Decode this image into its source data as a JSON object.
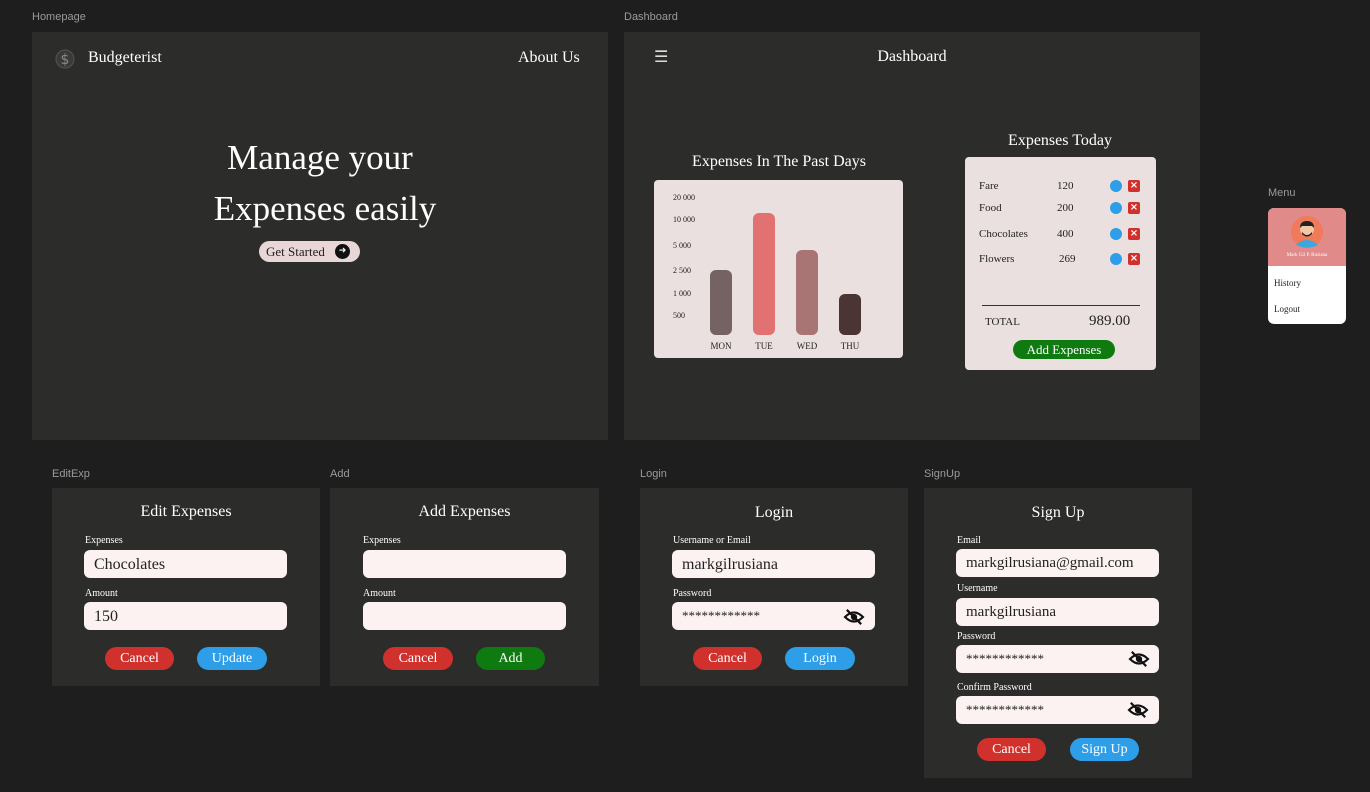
{
  "frames": {
    "homepage": "Homepage",
    "dashboard": "Dashboard",
    "menu": "Menu",
    "editexp": "EditExp",
    "add": "Add",
    "login": "Login",
    "signup": "SignUp"
  },
  "homepage": {
    "brand": "Budgeterist",
    "about": "About Us",
    "hero_line1": "Manage your",
    "hero_line2": "Expenses easily",
    "cta": "Get Started"
  },
  "dashboard": {
    "title": "Dashboard",
    "chart_title": "Expenses In The Past Days",
    "today_title": "Expenses Today",
    "items": [
      {
        "name": "Fare",
        "amount": "120"
      },
      {
        "name": "Food",
        "amount": "200"
      },
      {
        "name": "Chocolates",
        "amount": "400"
      },
      {
        "name": "Flowers",
        "amount": "269"
      }
    ],
    "total_label": "TOTAL",
    "total_value": "989.00",
    "add_button": "Add Expenses"
  },
  "chart_data": {
    "type": "bar",
    "title": "Expenses In The Past Days",
    "categories": [
      "MON",
      "TUE",
      "WED",
      "THU"
    ],
    "values": [
      1700,
      9000,
      3300,
      700
    ],
    "y_tick_labels": [
      "20 000",
      "10 000",
      "5 000",
      "2 500",
      "1 000",
      "500"
    ],
    "colors": [
      "#756363",
      "#e27272",
      "#a87474",
      "#4a3434"
    ],
    "grid": false
  },
  "menu": {
    "user": "Mark Gil P. Rusiana",
    "history": "History",
    "logout": "Logout"
  },
  "edit": {
    "title": "Edit Expenses",
    "expenses_label": "Expenses",
    "expenses_value": "Chocolates",
    "amount_label": "Amount",
    "amount_value": "150",
    "cancel": "Cancel",
    "update": "Update"
  },
  "add": {
    "title": "Add Expenses",
    "expenses_label": "Expenses",
    "amount_label": "Amount",
    "cancel": "Cancel",
    "add": "Add"
  },
  "login": {
    "title": "Login",
    "user_label": "Username or Email",
    "user_value": "markgilrusiana",
    "pass_label": "Password",
    "pass_value": "************",
    "cancel": "Cancel",
    "login": "Login"
  },
  "signup": {
    "title": "Sign Up",
    "email_label": "Email",
    "email_value": "markgilrusiana@gmail.com",
    "username_label": "Username",
    "username_value": "markgilrusiana",
    "pass_label": "Password",
    "pass_value": "************",
    "confirm_label": "Confirm Password",
    "confirm_value": "************",
    "cancel": "Cancel",
    "signup": "Sign Up"
  }
}
